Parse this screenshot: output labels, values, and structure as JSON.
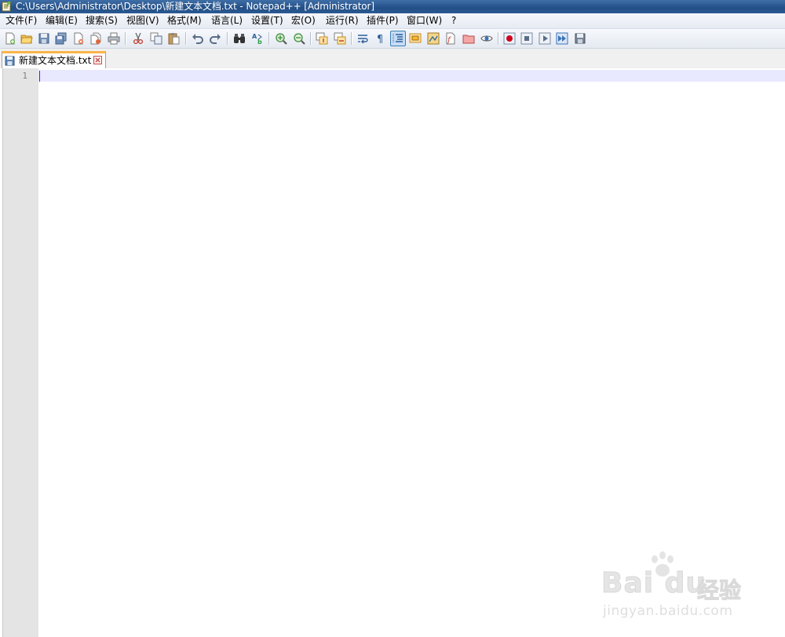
{
  "window": {
    "title": "C:\\Users\\Administrator\\Desktop\\新建文本文档.txt - Notepad++ [Administrator]"
  },
  "menu": {
    "items": [
      {
        "id": "file",
        "label": "文件(F)"
      },
      {
        "id": "edit",
        "label": "编辑(E)"
      },
      {
        "id": "search",
        "label": "搜索(S)"
      },
      {
        "id": "view",
        "label": "视图(V)"
      },
      {
        "id": "format",
        "label": "格式(M)"
      },
      {
        "id": "language",
        "label": "语言(L)"
      },
      {
        "id": "settings",
        "label": "设置(T)"
      },
      {
        "id": "macro",
        "label": "宏(O)"
      },
      {
        "id": "run",
        "label": "运行(R)"
      },
      {
        "id": "plugins",
        "label": "插件(P)"
      },
      {
        "id": "window",
        "label": "窗口(W)"
      },
      {
        "id": "help",
        "label": "?"
      }
    ]
  },
  "toolbar": {
    "buttons": [
      "new-file-icon",
      "open-file-icon",
      "save-icon",
      "save-all-icon",
      "close-icon",
      "close-all-icon",
      "print-icon",
      "cut-icon",
      "copy-icon",
      "paste-icon",
      "undo-icon",
      "redo-icon",
      "find-icon",
      "replace-icon",
      "zoom-in-icon",
      "zoom-out-icon",
      "sync-vertical-icon",
      "sync-horizontal-icon",
      "word-wrap-icon",
      "show-all-characters-icon",
      "indent-guide-icon",
      "user-defined-language-icon",
      "document-map-icon",
      "function-list-icon",
      "folder-as-workspace-icon",
      "monitoring-icon",
      "record-macro-icon",
      "stop-recording-icon",
      "playback-macro-icon",
      "run-macro-multiple-icon",
      "save-macro-icon"
    ],
    "active_button": "indent-guide-icon"
  },
  "tabs": [
    {
      "label": "新建文本文档.txt",
      "active": true
    }
  ],
  "editor": {
    "line_numbers": [
      "1"
    ],
    "content": ""
  },
  "watermark": {
    "brand": "Bai du",
    "brand_cn": "经验",
    "url": "jingyan.baidu.com"
  },
  "colors": {
    "titlebar": "#2a5a93",
    "tab_accent": "#fab44a",
    "current_line": "#e8e8ff",
    "caret": "#8000ff",
    "gutter": "#e4e4e4"
  }
}
